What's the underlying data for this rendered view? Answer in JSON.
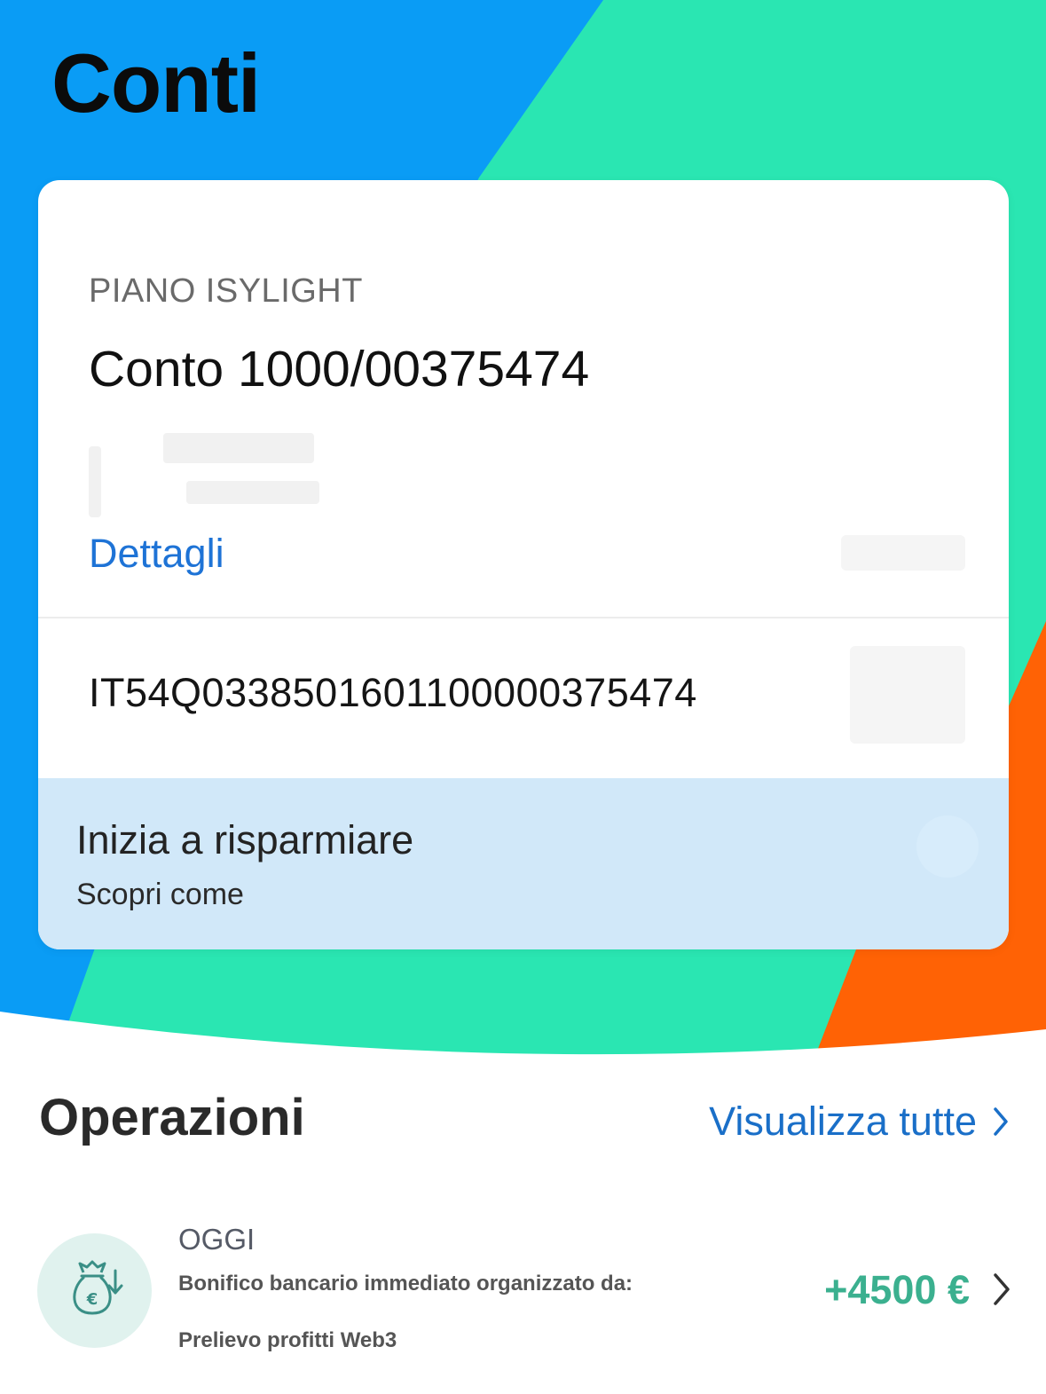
{
  "colors": {
    "hero_blue": "#0a9cf5",
    "hero_green": "#2ae6b2",
    "hero_orange": "#ff6205",
    "link_blue": "#1e73d6",
    "amount_green": "#3bb08f",
    "savings_banner_bg": "#d1e8f9"
  },
  "header": {
    "title": "Conti"
  },
  "account_card": {
    "plan_label": "PIANO ISYLIGHT",
    "account_number": "Conto 1000/00375474",
    "details_link": "Dettagli",
    "iban": "IT54Q0338501601100000375474"
  },
  "savings_banner": {
    "title": "Inizia a risparmiare",
    "subtitle": "Scopri come"
  },
  "operations": {
    "heading": "Operazioni",
    "see_all_label": "Visualizza tutte",
    "see_all_icon": "chevron-right-icon",
    "transactions": [
      {
        "icon": "money-bag-euro-icon",
        "date": "OGGI",
        "description_line1": "Bonifico bancario immediato organizzato da:",
        "description_line2": "Prelievo profitti Web3",
        "amount": "+4500 €"
      }
    ]
  }
}
